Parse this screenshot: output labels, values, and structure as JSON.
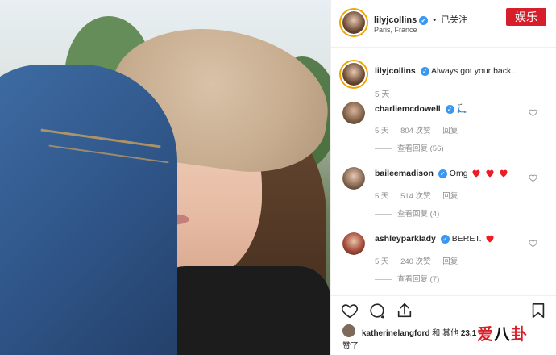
{
  "header": {
    "username": "lilyjcollins",
    "verified": "✓",
    "follow_state": "已关注",
    "separator": "•",
    "location": "Paris, France"
  },
  "watermark_top": "娱乐",
  "caption": {
    "username": "lilyjcollins",
    "text": "Always got your back...",
    "time": "5 天"
  },
  "comments": [
    {
      "username": "charliemcdowell",
      "text": "🛴",
      "time": "5 天",
      "likes": "804 次赞",
      "reply_label": "回复",
      "view_replies": "查看回复 (56)"
    },
    {
      "username": "baileemadison",
      "text": "Omg",
      "hearts": 3,
      "time": "5 天",
      "likes": "514 次赞",
      "reply_label": "回复",
      "view_replies": "查看回复 (4)"
    },
    {
      "username": "ashleyparklady",
      "text": "BERET.",
      "hearts": 1,
      "time": "5 天",
      "likes": "240 次赞",
      "reply_label": "回复",
      "view_replies": "查看回复 (7)"
    }
  ],
  "actions": {
    "icons": [
      "heart-icon",
      "comment-icon",
      "share-icon",
      "bookmark-icon"
    ]
  },
  "likes": {
    "liker": "katherinelangford",
    "suffix": "和 其他",
    "count_partial": "23,1",
    "second_line": "赞了"
  },
  "watermark_bottom": {
    "part1": "爱",
    "part2": "八",
    "part3": "卦"
  },
  "colors": {
    "accent": "#3897f0",
    "heart_red": "#ed1c24",
    "watermark_red": "#d61f2b"
  }
}
